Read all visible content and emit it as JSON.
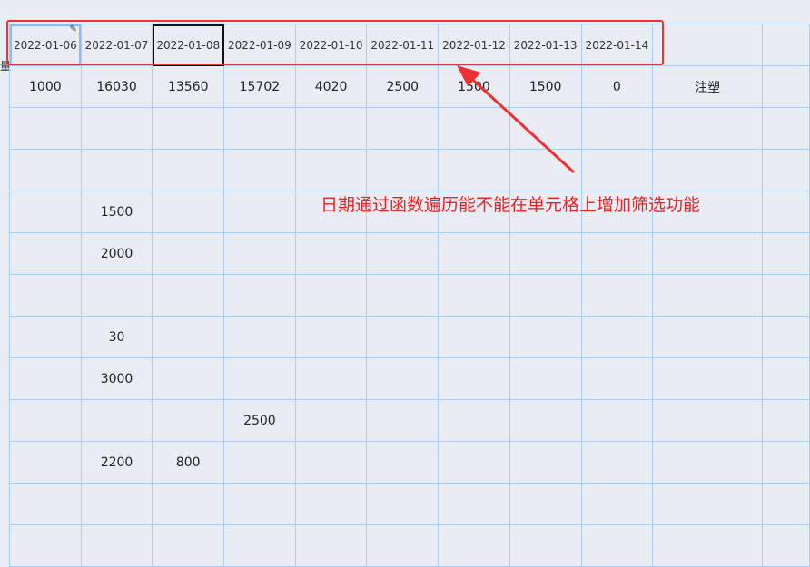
{
  "sheet_title": "",
  "row_stub": "量",
  "header_dates": [
    "2022-01-06",
    "2022-01-07",
    "2022-01-08",
    "2022-01-09",
    "2022-01-10",
    "2022-01-11",
    "2022-01-12",
    "2022-01-13",
    "2022-01-14"
  ],
  "totals": [
    "1000",
    "16030",
    "13560",
    "15702",
    "4020",
    "2500",
    "1500",
    "1500",
    "0",
    "注塑"
  ],
  "rows": [
    [
      "",
      "",
      "",
      "",
      "",
      "",
      "",
      "",
      "",
      "",
      ""
    ],
    [
      "",
      "",
      "",
      "",
      "",
      "",
      "",
      "",
      "",
      "",
      ""
    ],
    [
      "",
      "1500",
      "",
      "",
      "",
      "",
      "",
      "",
      "",
      "",
      ""
    ],
    [
      "",
      "2000",
      "",
      "",
      "",
      "",
      "",
      "",
      "",
      "",
      ""
    ],
    [
      "",
      "",
      "",
      "",
      "",
      "",
      "",
      "",
      "",
      "",
      ""
    ],
    [
      "",
      "30",
      "",
      "",
      "",
      "",
      "",
      "",
      "",
      "",
      ""
    ],
    [
      "",
      "3000",
      "",
      "",
      "",
      "",
      "",
      "",
      "",
      "",
      ""
    ],
    [
      "",
      "",
      "",
      "2500",
      "",
      "",
      "",
      "",
      "",
      "",
      ""
    ],
    [
      "",
      "2200",
      "800",
      "",
      "",
      "",
      "",
      "",
      "",
      "",
      ""
    ],
    [
      "",
      "",
      "",
      "",
      "",
      "",
      "",
      "",
      "",
      "",
      ""
    ],
    [
      "",
      "",
      "",
      "",
      "",
      "",
      "",
      "",
      "",
      "",
      ""
    ]
  ],
  "annotation": "日期通过函数遍历能不能在单元格上增加筛选功能",
  "colors": {
    "annotation": "#ef2020",
    "grid": "#a9cdf3",
    "background": "#e9ecf3"
  }
}
